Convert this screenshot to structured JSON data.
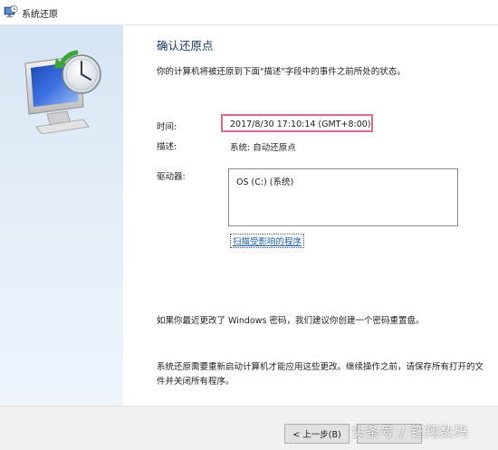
{
  "window": {
    "title": "系统还原"
  },
  "heading": "确认还原点",
  "intro": "你的计算机将被还原到下面\"描述\"字段中的事件之前所处的状态。",
  "fields": {
    "time_label": "时间:",
    "time_value": "2017/8/30 17:10:14 (GMT+8:00)",
    "desc_label": "描述:",
    "desc_value": "系统: 自动还原点",
    "drive_label": "驱动器:",
    "drive_items": [
      "OS (C:) (系统)"
    ]
  },
  "scan_link": "扫描受影响的程序",
  "note_password": "如果你最近更改了 Windows 密码，我们建议你创建一个密码重置盘。",
  "note_restart": "系统还原需要重新启动计算机才能应用这些更改。继续操作之前，请保存所有打开的文件并关闭所有程序。",
  "buttons": {
    "back": "< 上一步(B)",
    "next": ""
  },
  "watermark": "头条号 / 钰翔数码",
  "icons": {
    "title": "system-restore-icon",
    "hero": "monitor-clock-restore-icon"
  },
  "colors": {
    "highlight_border": "#e0688f",
    "link": "#1a5fb4",
    "heading": "#1a3a6e",
    "side_panel": "#d6e5f3"
  }
}
